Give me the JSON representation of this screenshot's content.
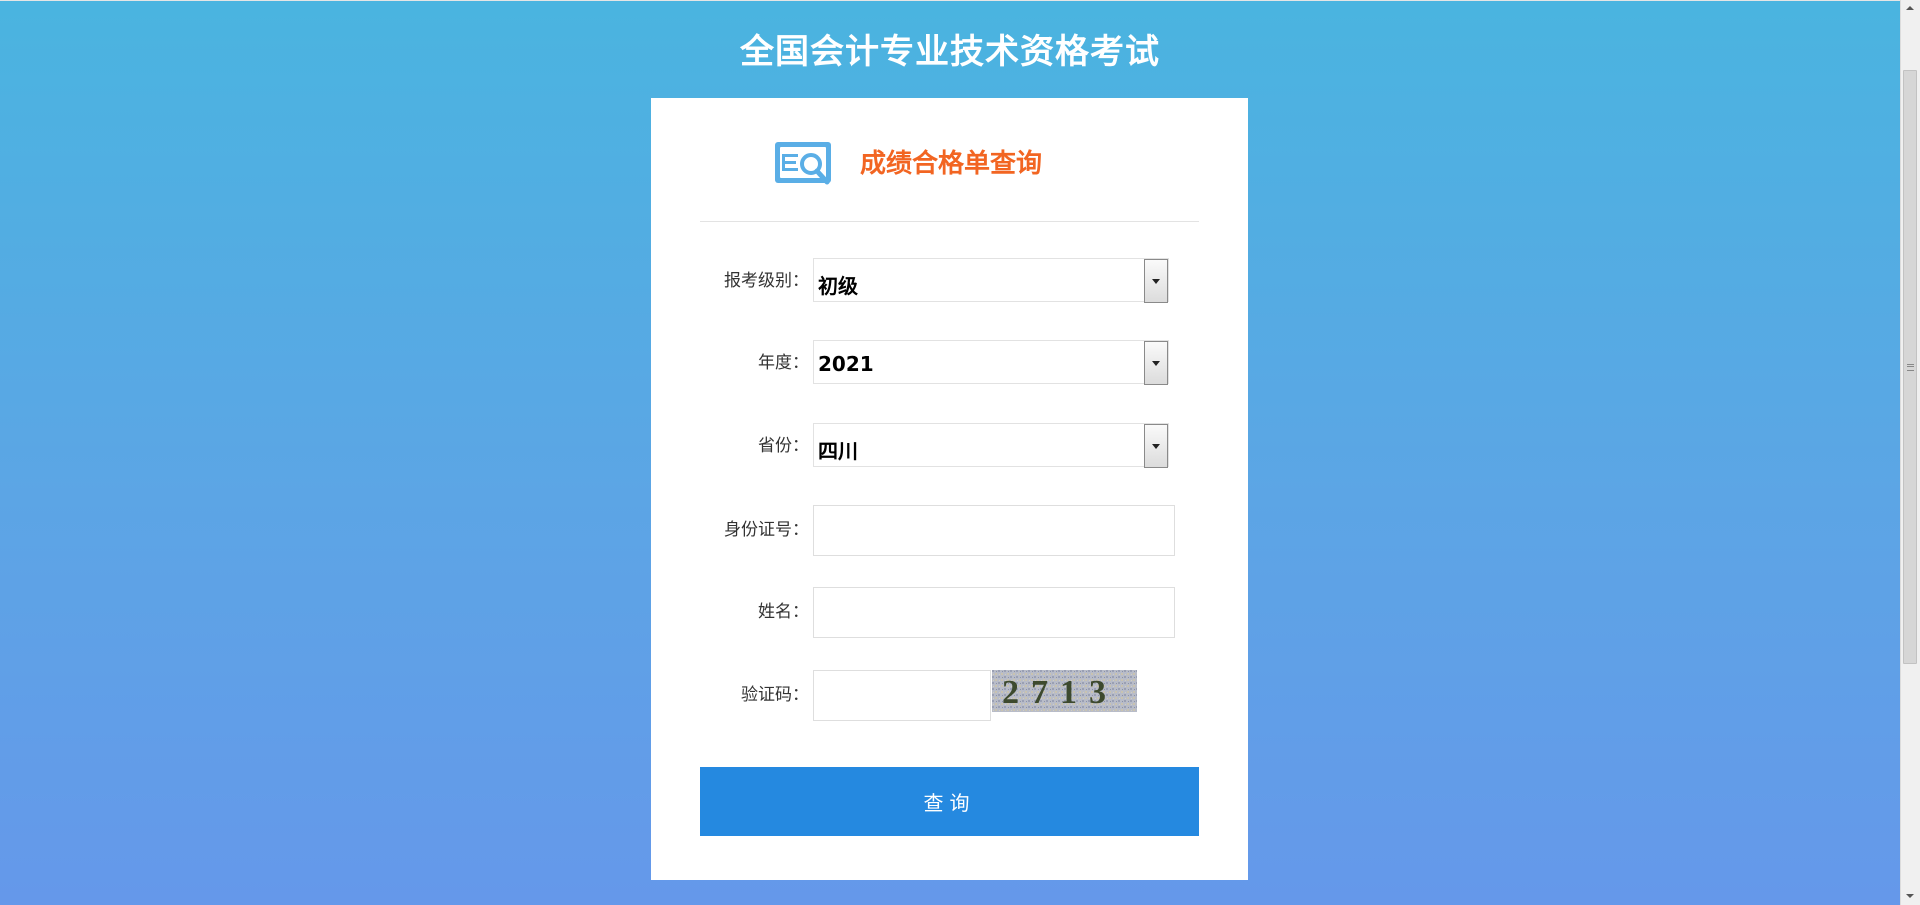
{
  "page": {
    "title": "全国会计专业技术资格考试"
  },
  "card": {
    "header_title": "成绩合格单查询",
    "header_icon": "search-document-icon"
  },
  "form": {
    "level": {
      "label": "报考级别：",
      "value": "初级"
    },
    "year": {
      "label": "年度：",
      "value": "2021"
    },
    "province": {
      "label": "省份：",
      "value": "四川"
    },
    "id_number": {
      "label": "身份证号：",
      "value": "",
      "placeholder": ""
    },
    "name": {
      "label": "姓名：",
      "value": "",
      "placeholder": ""
    },
    "captcha": {
      "label": "验证码：",
      "value": "",
      "placeholder": "",
      "image_text": "2713"
    },
    "submit_label": "查询"
  },
  "colors": {
    "gradient_top": "#4ab4e0",
    "gradient_bottom": "#6598ea",
    "header_title": "#f26522",
    "submit_button": "#2589e0"
  }
}
